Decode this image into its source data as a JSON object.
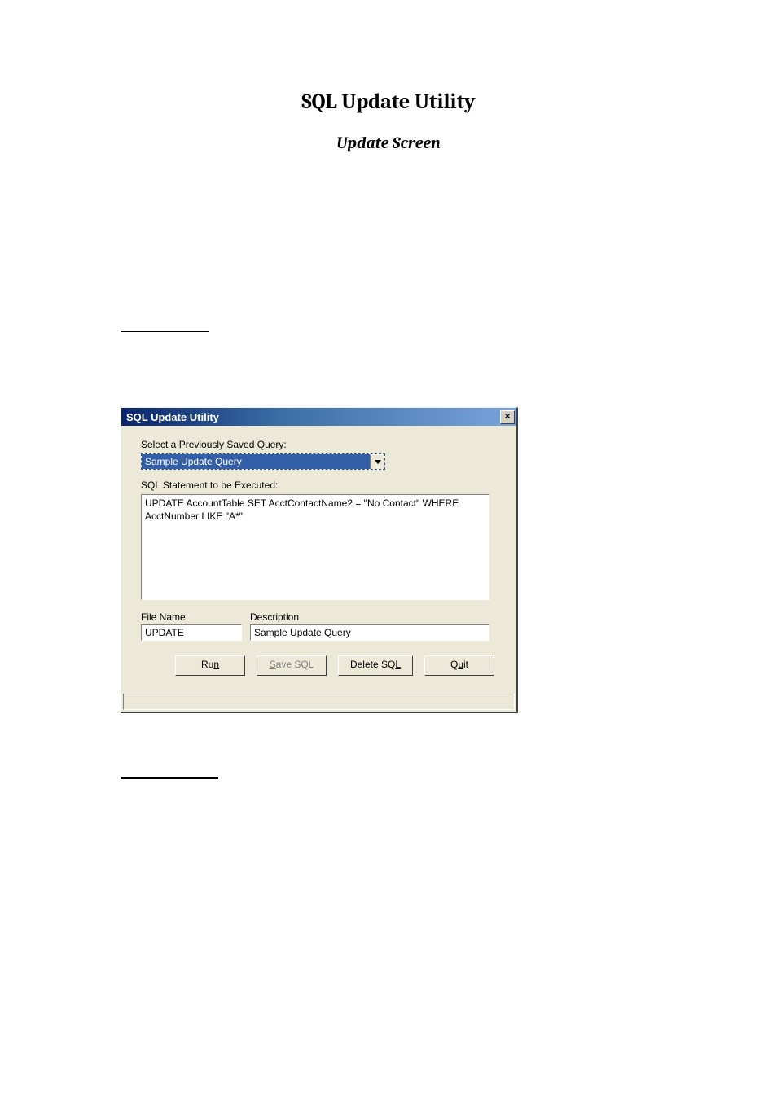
{
  "doc": {
    "title": "SQL Update Utility",
    "subtitle": "Update Screen"
  },
  "window": {
    "title": "SQL Update Utility",
    "select_query_label": "Select a Previously Saved Query:",
    "selected_query": "Sample Update Query",
    "sql_label": "SQL Statement to be Executed:",
    "sql_text": "UPDATE AccountTable SET AcctContactName2 = \"No Contact\" WHERE AcctNumber LIKE \"A*\"",
    "filename_label": "File Name",
    "filename_value": "UPDATE",
    "description_label": "Description",
    "description_value": "Sample Update Query",
    "buttons": {
      "run_pre": "Ru",
      "run_u": "n",
      "save_pre": "",
      "save_u": "S",
      "save_post": "ave SQL",
      "delete_pre": "Delete SQ",
      "delete_u": "L",
      "quit_pre": "Q",
      "quit_u": "u",
      "quit_post": "it"
    }
  }
}
